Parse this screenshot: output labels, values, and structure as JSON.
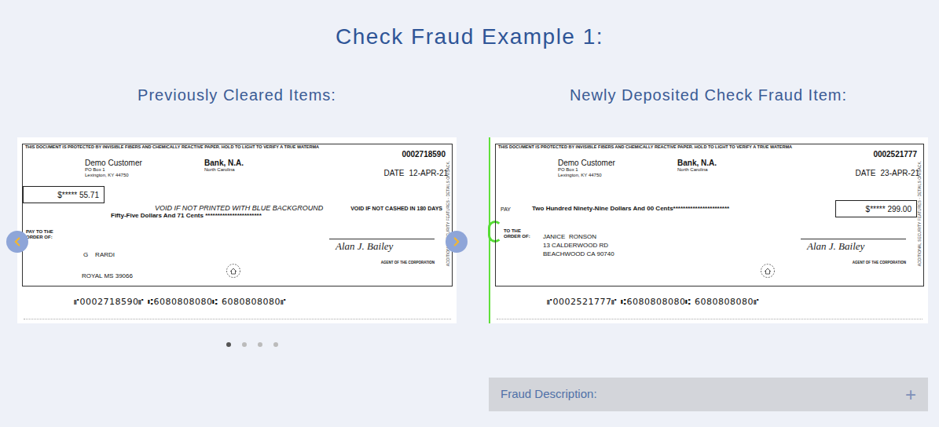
{
  "title": "Check Fraud Example 1:",
  "cleared": {
    "heading": "Previously Cleared Items:",
    "slides": [
      {
        "selected": true
      },
      {
        "selected": false
      },
      {
        "selected": false
      },
      {
        "selected": false
      }
    ],
    "check": {
      "kind": "cleared",
      "security_text": "THIS DOCUMENT IS PROTECTED BY INVISIBLE FIBERS AND CHEMICALLY REACTIVE PAPER. HOLD TO LIGHT TO VERIFY A TRUE WATERMA",
      "number": "0002718590",
      "customer": {
        "name": "Demo Customer",
        "lines": [
          "PO Box 1",
          "Lexington, KY 44750"
        ]
      },
      "bank": {
        "name": "Bank, N.A.",
        "location": "North Carolina"
      },
      "date_label": "DATE",
      "date": "12-APR-21",
      "amount": "$***** 55.71",
      "void_notes": [
        "VOID IF NOT PRINTED WITH BLUE BACKGROUND",
        "VOID IF NOT CASHED IN 180 DAYS"
      ],
      "amount_words": "Fifty-Five Dollars And 71 Cents ***********************",
      "order_label": [
        "PAY TO THE",
        "ORDER OF:"
      ],
      "payee_lines": [
        "G    RARDI",
        "ROYAL MS 39066"
      ],
      "signature": "Alan J. Bailey",
      "agent": "AGENT OF THE CORPORATION",
      "side_text": "ADDITIONAL SECURITY FEATURES - DETAILS ON BACK.",
      "micr": "⑈0002718590⑈ ⑆6080808080⑆ 6080808080⑈"
    }
  },
  "fraud": {
    "heading": "Newly Deposited Check Fraud Item:",
    "highlighted": true,
    "check": {
      "kind": "deposited",
      "security_text": "THIS DOCUMENT IS PROTECTED BY INVISIBLE FIBERS AND CHEMICALLY REACTIVE PAPER. HOLD TO LIGHT TO VERIFY A TRUE WATERMA",
      "number": "0002521777",
      "customer": {
        "name": "Demo Customer",
        "lines": [
          "PO Box 1",
          "Lexington, KY 44750"
        ]
      },
      "bank": {
        "name": "Bank, N.A.",
        "location": "North Carolina"
      },
      "date_label": "DATE",
      "date": "23-APR-21",
      "amount": "$***** 299.00",
      "pay_label": "PAY",
      "amount_words": "Two Hundred Ninety-Nine Dollars And 00 Cents***********************",
      "order_label": [
        "TO THE",
        "ORDER OF:"
      ],
      "payee_lines": [
        "JANICE  RONSON",
        "13 CALDERWOOD RD",
        "BEACHWOOD CA 90740"
      ],
      "signature": "Alan J. Bailey",
      "agent": "AGENT OF THE CORPORATION",
      "side_text": "ADDITIONAL SECURITY FEATURES - DETAILS ON BACK.",
      "micr": "⑈0002521777⑈ ⑆6080808080⑆ 6080808080⑈"
    },
    "description": {
      "label": "Fraud Description:",
      "toggle": "+",
      "expanded": false
    }
  }
}
